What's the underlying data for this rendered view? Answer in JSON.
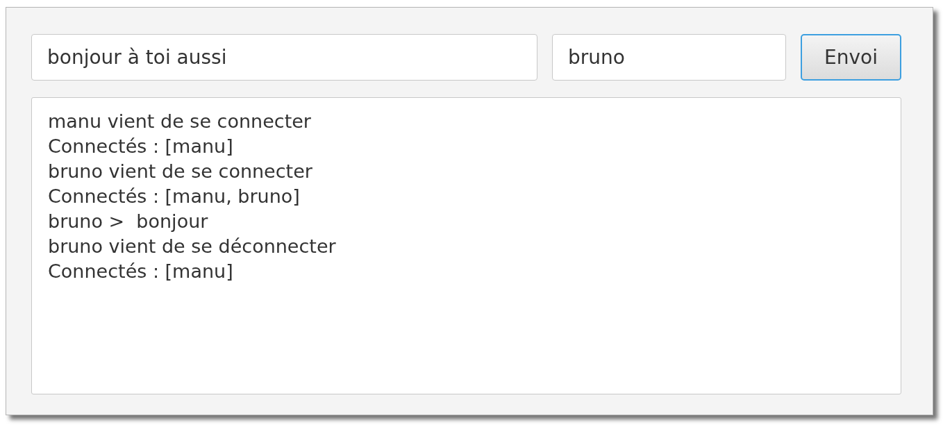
{
  "message_field": {
    "value": "bonjour à toi aussi"
  },
  "name_field": {
    "value": "bruno"
  },
  "send_button": {
    "label": "Envoi",
    "focused": true
  },
  "log": [
    "manu vient de se connecter",
    "Connectés : [manu]",
    "bruno vient de se connecter",
    "Connectés : [manu, bruno]",
    "bruno >  bonjour",
    "bruno vient de se déconnecter",
    "Connectés : [manu]"
  ]
}
